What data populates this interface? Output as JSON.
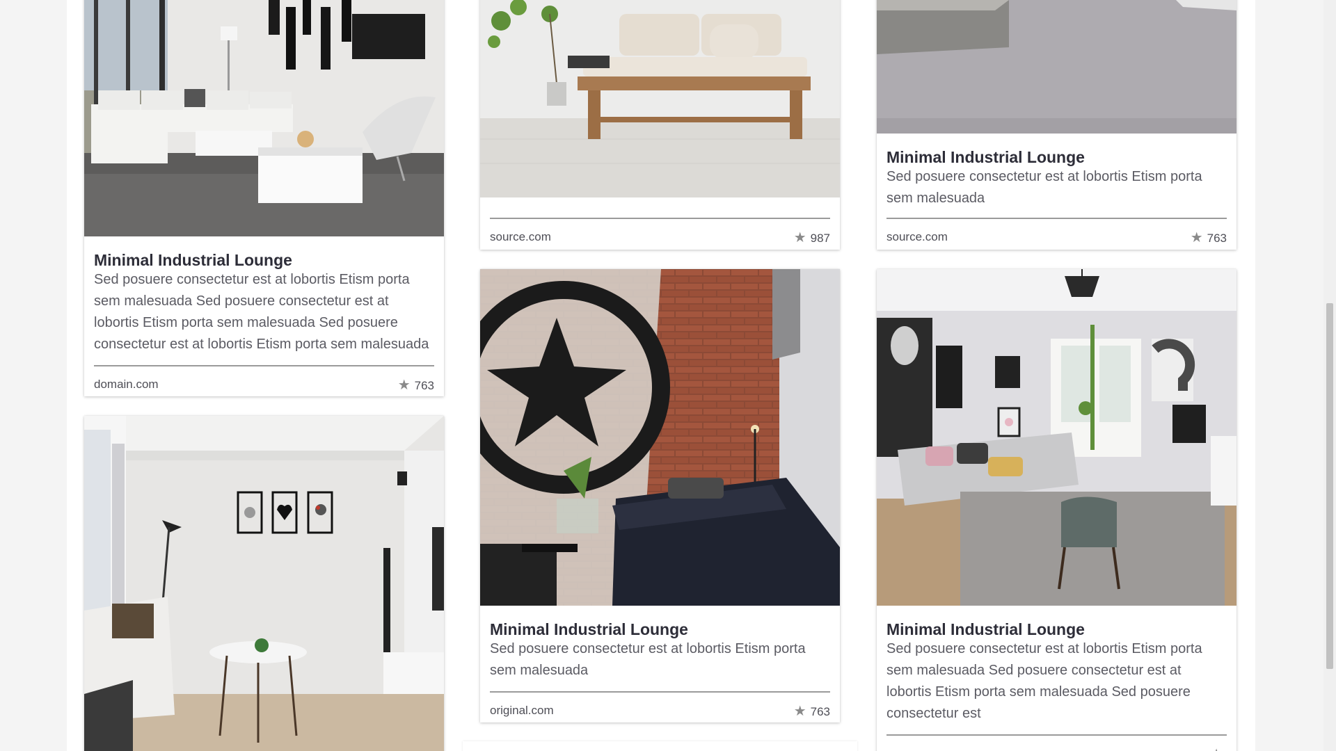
{
  "cards": [
    {
      "title": "Minimal Industrial Lounge",
      "description": "Sed posuere consectetur est at lobortis Etism porta sem malesuada Sed posuere consectetur est at lobortis Etism porta sem malesuada Sed posuere consectetur est at lobortis Etism porta sem malesuada",
      "source": "domain.com",
      "stars": "763"
    },
    {
      "title": "",
      "description": "",
      "source": "source.com",
      "stars": "987"
    },
    {
      "title": "Minimal Industrial Lounge",
      "description": "Sed posuere consectetur est at lobortis Etism porta sem malesuada",
      "source": "source.com",
      "stars": "763"
    },
    {
      "title": "Minimal Industrial Lounge",
      "description": "Sed posuere consectetur est at lobortis Etism porta sem malesuada",
      "source": "original.com",
      "stars": "763"
    },
    {
      "title": "Minimal Industrial Lounge",
      "description": "Sed posuere consectetur est at lobortis Etism porta sem malesuada Sed posuere consectetur est at lobortis Etism porta sem malesuada Sed posuere consectetur est",
      "source": "",
      "stars": ""
    }
  ],
  "icons": {
    "star": "star-icon"
  },
  "colors": {
    "page_bg": "#f4f4f4",
    "card_bg": "#ffffff",
    "title": "#2d2d38",
    "text": "#5b5b63",
    "rule": "#9a9a9a"
  }
}
